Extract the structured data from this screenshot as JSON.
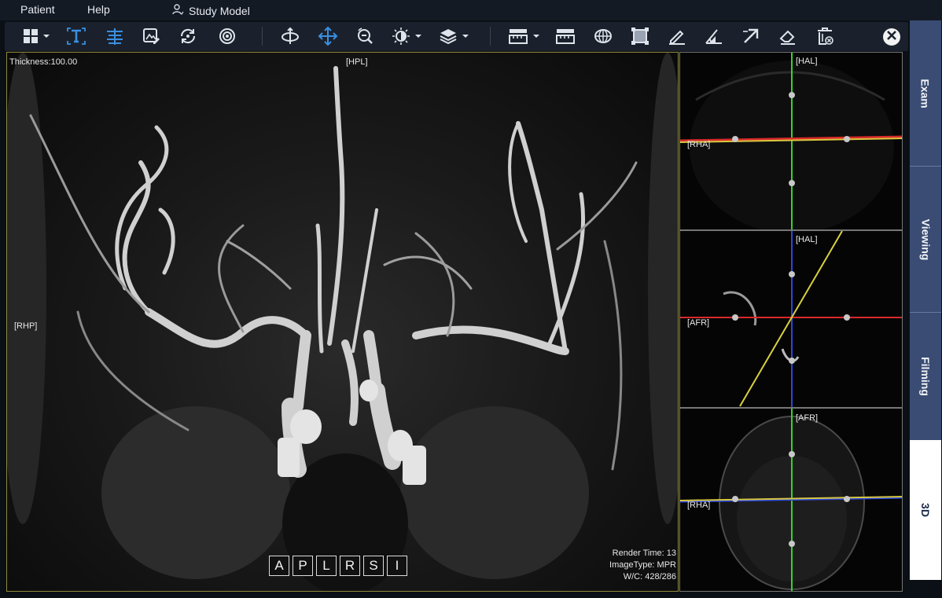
{
  "menu": {
    "patient": "Patient",
    "help": "Help",
    "study_model": "Study Model"
  },
  "toolbar": {
    "icons": [
      "layout-icon",
      "text-icon",
      "align-icon",
      "edit-image-icon",
      "rotate-icon",
      "reset-icon",
      "rotate-3d-icon",
      "pan-icon",
      "zoom-icon",
      "brightness-icon",
      "layers-icon",
      "ruler-icon",
      "measure-icon",
      "ellipse-roi-icon",
      "rect-roi-icon",
      "freehand-icon",
      "angle-icon",
      "arrow-icon",
      "eraser-icon",
      "delete-all-icon",
      "close-icon"
    ],
    "accent": "#3a8fe0"
  },
  "main_view": {
    "thickness": "Thickness:100.00",
    "top_label": "[HPL]",
    "left_label": "[RHP]",
    "render_time": "Render Time: 13",
    "image_type": "ImageType: MPR",
    "wc": "W/C: 428/286",
    "orientation_buttons": [
      "A",
      "P",
      "L",
      "R",
      "S",
      "I"
    ]
  },
  "side_views": [
    {
      "top_label": "[HAL]",
      "left_label": "[RHA]",
      "h_color": "#d8c840",
      "v_color": "#37d42b"
    },
    {
      "top_label": "[HAL]",
      "left_label": "[AFR]",
      "h_color": "#d92a2a",
      "v_color": "#2a48e0",
      "diag_color": "#d8d040"
    },
    {
      "top_label": "[AFR]",
      "left_label": "[RHA]",
      "h_color": "#d8c840",
      "v_color": "#37d42b"
    }
  ],
  "tabs": [
    "Exam",
    "Viewing",
    "Filming",
    "3D"
  ],
  "active_tab": "3D"
}
